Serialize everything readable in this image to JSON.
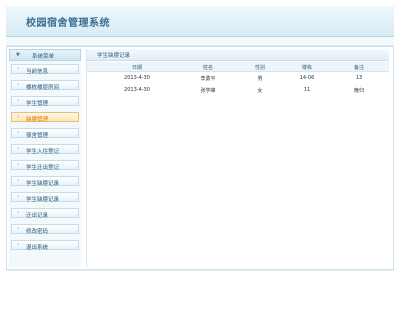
{
  "app": {
    "title": "校园宿舍管理系统"
  },
  "sidebar": {
    "header": "系统菜单",
    "items": [
      {
        "label": "当前信息"
      },
      {
        "label": "楼栋楼层房间"
      },
      {
        "label": "学生管理"
      },
      {
        "label": "缺寝管理"
      },
      {
        "label": "宿舍管理"
      },
      {
        "label": "学生入住登记"
      },
      {
        "label": "学生迁出登记"
      },
      {
        "label": "学生缺寝记录"
      },
      {
        "label": "学生缺寝记录"
      },
      {
        "label": "迁出记录"
      },
      {
        "label": "修改密码"
      },
      {
        "label": "退出系统"
      }
    ]
  },
  "main": {
    "title": "学生缺寝记录",
    "columns": [
      "日期",
      "姓名",
      "性别",
      "楼栋",
      "备注"
    ],
    "rows": [
      {
        "date": "2013-4-30",
        "name": "李勇平",
        "gender": "男",
        "building": "14-06",
        "note": "13"
      },
      {
        "date": "2013-4-30",
        "name": "张学峰",
        "gender": "女",
        "building": "11",
        "note": "晚归"
      }
    ]
  }
}
